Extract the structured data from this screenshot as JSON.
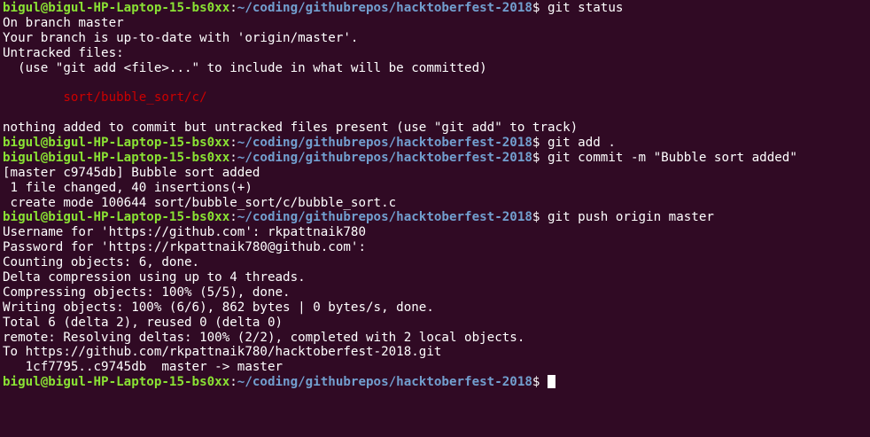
{
  "terminal": {
    "colors": {
      "background": "#300a24",
      "foreground": "#ffffff",
      "prompt_user": "#8ae234",
      "prompt_path": "#729fcf",
      "untracked": "#cc0000"
    },
    "prompt": {
      "user_host": "bigul@bigul-HP-Laptop-15-bs0xx",
      "sep": ":",
      "path": "~/coding/githubrepos/hacktoberfest-2018",
      "symbol": "$"
    },
    "lines": [
      {
        "type": "prompt",
        "cmd": " git status"
      },
      {
        "type": "text",
        "text": "On branch master"
      },
      {
        "type": "text",
        "text": "Your branch is up-to-date with 'origin/master'."
      },
      {
        "type": "text",
        "text": "Untracked files:"
      },
      {
        "type": "text",
        "text": "  (use \"git add <file>...\" to include in what will be committed)"
      },
      {
        "type": "text",
        "text": ""
      },
      {
        "type": "red",
        "text": "        sort/bubble_sort/c/"
      },
      {
        "type": "text",
        "text": ""
      },
      {
        "type": "text",
        "text": "nothing added to commit but untracked files present (use \"git add\" to track)"
      },
      {
        "type": "prompt",
        "cmd": " git add ."
      },
      {
        "type": "prompt",
        "cmd": " git commit -m \"Bubble sort added\""
      },
      {
        "type": "text",
        "text": "[master c9745db] Bubble sort added"
      },
      {
        "type": "text",
        "text": " 1 file changed, 40 insertions(+)"
      },
      {
        "type": "text",
        "text": " create mode 100644 sort/bubble_sort/c/bubble_sort.c"
      },
      {
        "type": "prompt",
        "cmd": " git push origin master"
      },
      {
        "type": "text",
        "text": "Username for 'https://github.com': rkpattnaik780"
      },
      {
        "type": "text",
        "text": "Password for 'https://rkpattnaik780@github.com':"
      },
      {
        "type": "text",
        "text": "Counting objects: 6, done."
      },
      {
        "type": "text",
        "text": "Delta compression using up to 4 threads."
      },
      {
        "type": "text",
        "text": "Compressing objects: 100% (5/5), done."
      },
      {
        "type": "text",
        "text": "Writing objects: 100% (6/6), 862 bytes | 0 bytes/s, done."
      },
      {
        "type": "text",
        "text": "Total 6 (delta 2), reused 0 (delta 0)"
      },
      {
        "type": "text",
        "text": "remote: Resolving deltas: 100% (2/2), completed with 2 local objects."
      },
      {
        "type": "text",
        "text": "To https://github.com/rkpattnaik780/hacktoberfest-2018.git"
      },
      {
        "type": "text",
        "text": "   1cf7795..c9745db  master -> master"
      },
      {
        "type": "prompt",
        "cmd": " ",
        "cursor": true
      }
    ]
  }
}
